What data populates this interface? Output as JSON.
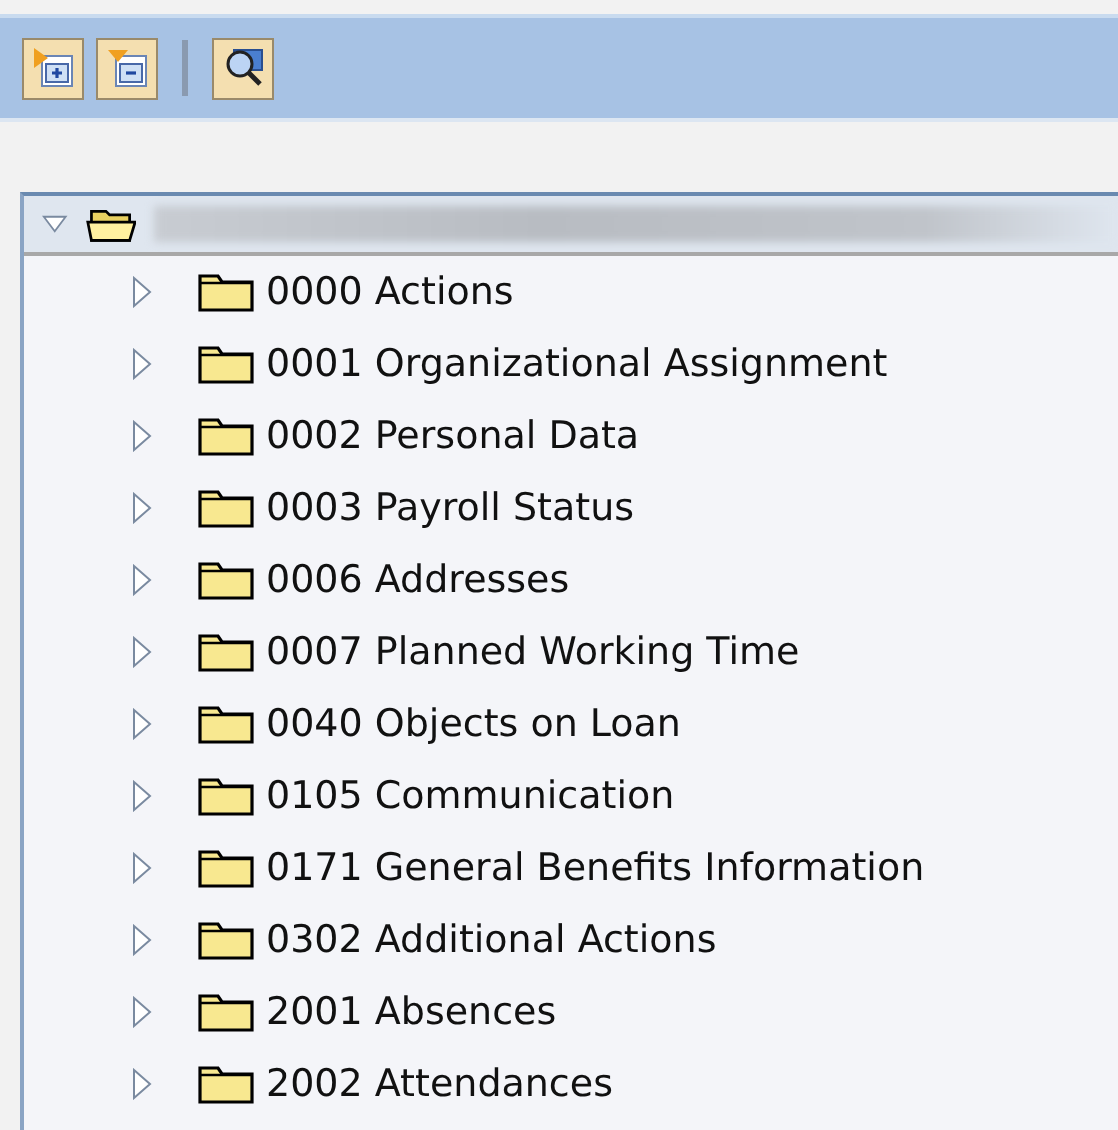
{
  "toolbar": {
    "buttons": [
      {
        "kind": "expand"
      },
      {
        "kind": "collapse"
      },
      {
        "kind": "find"
      }
    ]
  },
  "tree": {
    "root": {
      "expanded": true,
      "children": [
        {
          "label": "0000 Actions",
          "expanded": false
        },
        {
          "label": "0001 Organizational Assignment",
          "expanded": false
        },
        {
          "label": "0002 Personal Data",
          "expanded": false
        },
        {
          "label": "0003 Payroll Status",
          "expanded": false
        },
        {
          "label": "0006 Addresses",
          "expanded": false
        },
        {
          "label": "0007 Planned Working Time",
          "expanded": false
        },
        {
          "label": "0040 Objects on Loan",
          "expanded": false
        },
        {
          "label": "0105 Communication",
          "expanded": false
        },
        {
          "label": "0171 General Benefits Information",
          "expanded": false
        },
        {
          "label": "0302 Additional Actions",
          "expanded": false
        },
        {
          "label": "2001 Absences",
          "expanded": false
        },
        {
          "label": "2002 Attendances",
          "expanded": false
        }
      ]
    }
  }
}
